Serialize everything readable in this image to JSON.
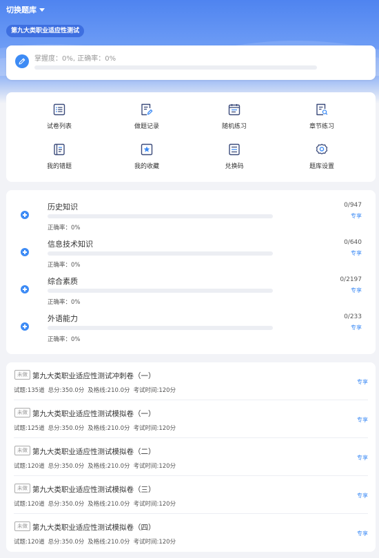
{
  "header": {
    "switch_label": "切换题库",
    "bank_name": "第九大类职业适应性测试"
  },
  "stats": {
    "text": "掌握度：0%, 正确率：0%",
    "mastery_fraction": 0
  },
  "colors": {
    "accent": "#3d8bf5",
    "header_top": "#4f84f0",
    "badge_border": "#aaaaaa"
  },
  "menu": {
    "items": [
      {
        "label": "试卷列表",
        "icon": "list-icon"
      },
      {
        "label": "做题记录",
        "icon": "edit-record-icon"
      },
      {
        "label": "随机练习",
        "icon": "calendar-icon"
      },
      {
        "label": "章节练习",
        "icon": "doc-search-icon"
      },
      {
        "label": "我的错题",
        "icon": "notebook-icon"
      },
      {
        "label": "我的收藏",
        "icon": "star-icon"
      },
      {
        "label": "兑换码",
        "icon": "code-list-icon"
      },
      {
        "label": "题库设置",
        "icon": "gear-icon"
      }
    ]
  },
  "categories": [
    {
      "name": "历史知识",
      "count": "0/947",
      "accuracy": "正确率：0%",
      "share": "专享",
      "progress": 0
    },
    {
      "name": "信息技术知识",
      "count": "0/640",
      "accuracy": "正确率：0%",
      "share": "专享",
      "progress": 0
    },
    {
      "name": "综合素质",
      "count": "0/2197",
      "accuracy": "正确率：0%",
      "share": "专享",
      "progress": 0
    },
    {
      "name": "外语能力",
      "count": "0/233",
      "accuracy": "正确率：0%",
      "share": "专享",
      "progress": 0
    }
  ],
  "papers": [
    {
      "badge": "未做",
      "title": "第九大类职业适应性测试冲刺卷（一）",
      "questions": "试题:135道",
      "total": "总分:350.0分",
      "pass": "及格线:210.0分",
      "time": "考试时间:120分",
      "share": "专享"
    },
    {
      "badge": "未做",
      "title": "第九大类职业适应性测试模拟卷（一）",
      "questions": "试题:125道",
      "total": "总分:350.0分",
      "pass": "及格线:210.0分",
      "time": "考试时间:120分",
      "share": "专享"
    },
    {
      "badge": "未做",
      "title": "第九大类职业适应性测试模拟卷（二）",
      "questions": "试题:120道",
      "total": "总分:350.0分",
      "pass": "及格线:210.0分",
      "time": "考试时间:120分",
      "share": "专享"
    },
    {
      "badge": "未做",
      "title": "第九大类职业适应性测试模拟卷（三）",
      "questions": "试题:120道",
      "total": "总分:350.0分",
      "pass": "及格线:210.0分",
      "time": "考试时间:120分",
      "share": "专享"
    },
    {
      "badge": "未做",
      "title": "第九大类职业适应性测试模拟卷（四）",
      "questions": "试题:120道",
      "total": "总分:350.0分",
      "pass": "及格线:210.0分",
      "time": "考试时间:120分",
      "share": "专享"
    }
  ]
}
